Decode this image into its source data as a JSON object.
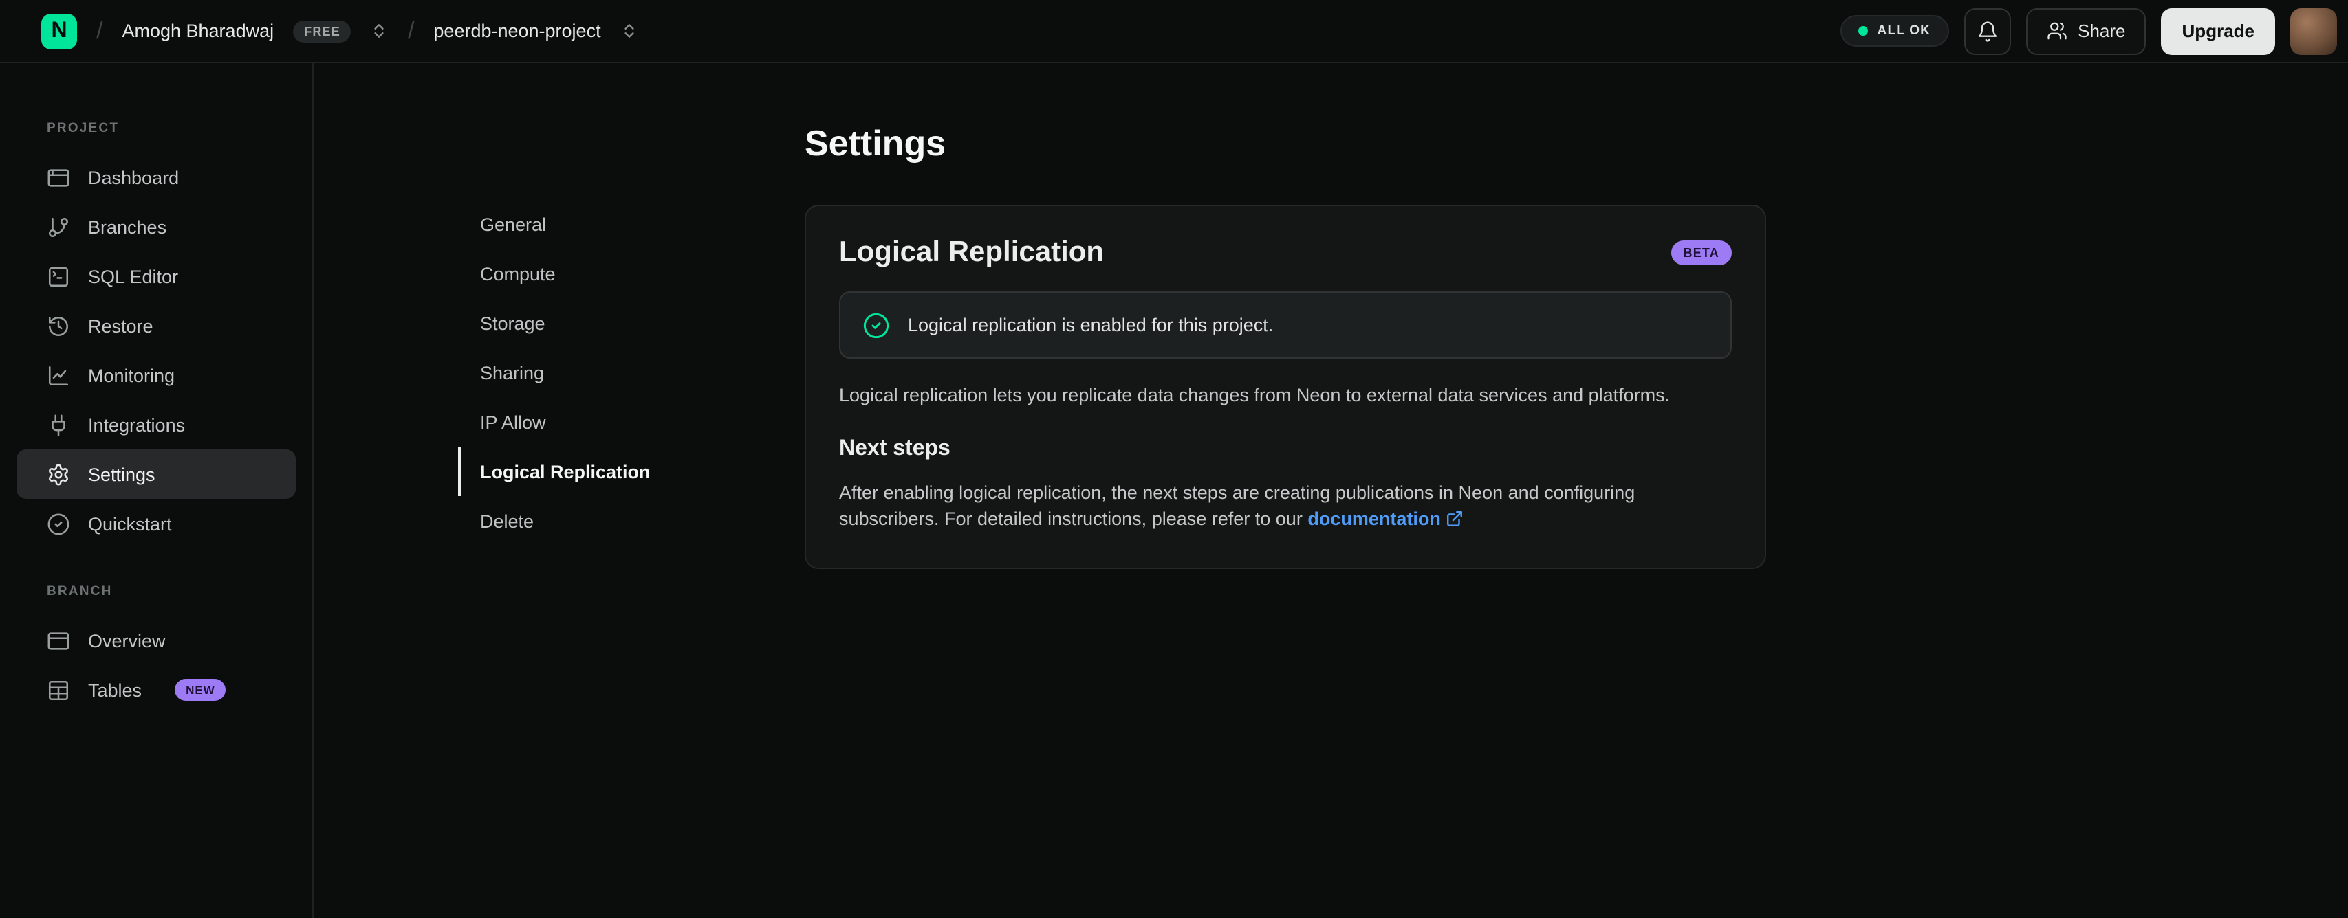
{
  "brand": {
    "logo_letter": "N"
  },
  "header": {
    "org_name": "Amogh Bharadwaj",
    "org_badge": "FREE",
    "project_name": "peerdb-neon-project",
    "status_label": "ALL OK",
    "share_label": "Share",
    "upgrade_label": "Upgrade"
  },
  "sidebar": {
    "project_section": {
      "label": "PROJECT",
      "items": [
        {
          "label": "Dashboard"
        },
        {
          "label": "Branches"
        },
        {
          "label": "SQL Editor"
        },
        {
          "label": "Restore"
        },
        {
          "label": "Monitoring"
        },
        {
          "label": "Integrations"
        },
        {
          "label": "Settings"
        },
        {
          "label": "Quickstart"
        }
      ]
    },
    "branch_section": {
      "label": "BRANCH",
      "items": [
        {
          "label": "Overview"
        },
        {
          "label": "Tables",
          "badge": "NEW"
        }
      ]
    }
  },
  "main": {
    "page_title": "Settings",
    "settings_nav": [
      "General",
      "Compute",
      "Storage",
      "Sharing",
      "IP Allow",
      "Logical Replication",
      "Delete"
    ],
    "card": {
      "title": "Logical Replication",
      "badge": "BETA",
      "alert_text": "Logical replication is enabled for this project.",
      "description": "Logical replication lets you replicate data changes from Neon to external data services and platforms.",
      "subheading": "Next steps",
      "next_steps_before_link": "After enabling logical replication, the next steps are creating publications in Neon and configuring subscribers. For detailed instructions, please refer to our ",
      "link_label": "documentation"
    }
  },
  "colors": {
    "accent_green": "#00e599",
    "badge_purple": "#9d7bf5",
    "link_blue": "#4f9cf9",
    "page_background": "#0b0c0c",
    "card_background": "#141616"
  }
}
